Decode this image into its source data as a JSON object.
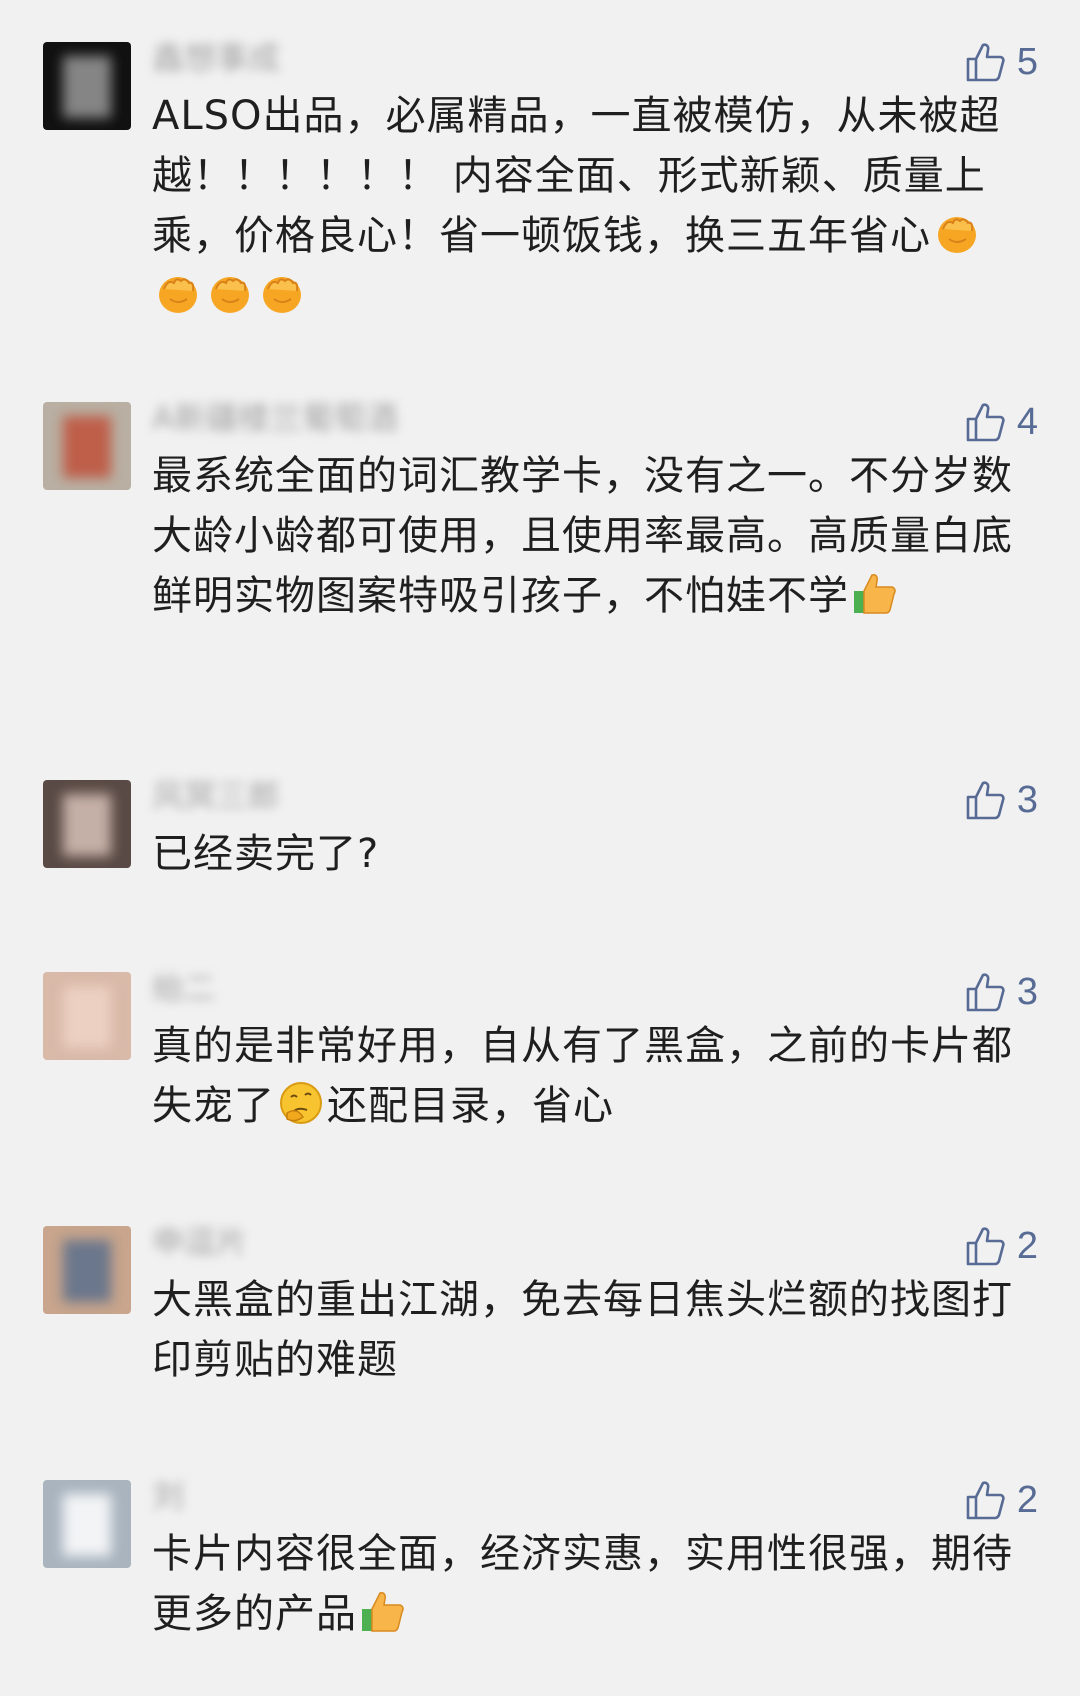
{
  "comments": [
    {
      "nickname": "鑫想事成",
      "likes": "5",
      "text": "ALSO出品，必属精品，一直被模仿，从未被超越！！！！！！ 内容全面、形式新颖、质量上乘，价格良心！省一顿饭钱，换三五年省心",
      "emoji": "fist-emoji",
      "emoji_count": 4,
      "avatar": {
        "bg": "#111111",
        "fg": "#9a9a9a"
      }
    },
    {
      "nickname": "A新疆楼兰葡萄酒",
      "likes": "4",
      "text": "最系统全面的词汇教学卡，没有之一。不分岁数大龄小龄都可使用，且使用率最高。高质量白底鲜明实物图案特吸引孩子，不怕娃不学",
      "emoji": "thumbs-up-emoji",
      "emoji_count": 1,
      "avatar": {
        "bg": "#b9b0a3",
        "fg": "#c0503a"
      }
    },
    {
      "nickname": "风冥三郎",
      "likes": "3",
      "text": "已经卖完了?",
      "emoji": "",
      "emoji_count": 0,
      "avatar": {
        "bg": "#5a4a45",
        "fg": "#d8c2b8"
      }
    },
    {
      "nickname": "绐二",
      "likes": "3",
      "text_before": "真的是非常好用，自从有了黑盒，之前的卡片都失宠了",
      "text_after": "还配目录，省心",
      "emoji": "thinking-face-emoji",
      "emoji_count": 1,
      "avatar": {
        "bg": "#d9b9a8",
        "fg": "#efd4c7"
      }
    },
    {
      "nickname": "申逗片",
      "likes": "2",
      "text": "大黑盒的重出江湖，免去每日焦头烂额的找图打印剪贴的难题",
      "emoji": "",
      "emoji_count": 0,
      "avatar": {
        "bg": "#c8a58c",
        "fg": "#5b6f8c"
      }
    },
    {
      "nickname": "刘",
      "likes": "2",
      "text": "卡片内容很全面，经济实惠，实用性很强，期待更多的产品",
      "emoji": "thumbs-up-emoji",
      "emoji_count": 1,
      "avatar": {
        "bg": "#a9b4bf",
        "fg": "#ffffff"
      }
    }
  ],
  "colors": {
    "background": "#f1f1f1",
    "text": "#1f1f1f",
    "like_icon": "#576b95",
    "like_count": "#576b95"
  }
}
